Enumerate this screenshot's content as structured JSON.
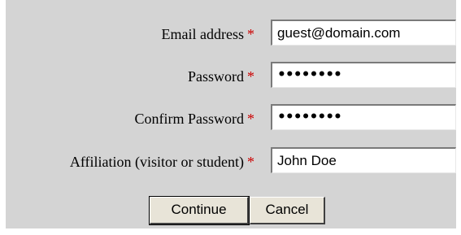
{
  "form": {
    "fields": [
      {
        "label": "Email address",
        "required_mark": "*",
        "value": "guest@domain.com"
      },
      {
        "label": "Password",
        "required_mark": "*",
        "value": "••••••••"
      },
      {
        "label": "Confirm Password",
        "required_mark": "*",
        "value": "••••••••"
      },
      {
        "label": "Affiliation (visitor or student)",
        "required_mark": "*",
        "value": "John Doe"
      }
    ],
    "buttons": {
      "continue_label": "Continue",
      "cancel_label": "Cancel"
    }
  },
  "colors": {
    "panel_background": "#d4d4d4",
    "required_mark": "#cc0000"
  }
}
